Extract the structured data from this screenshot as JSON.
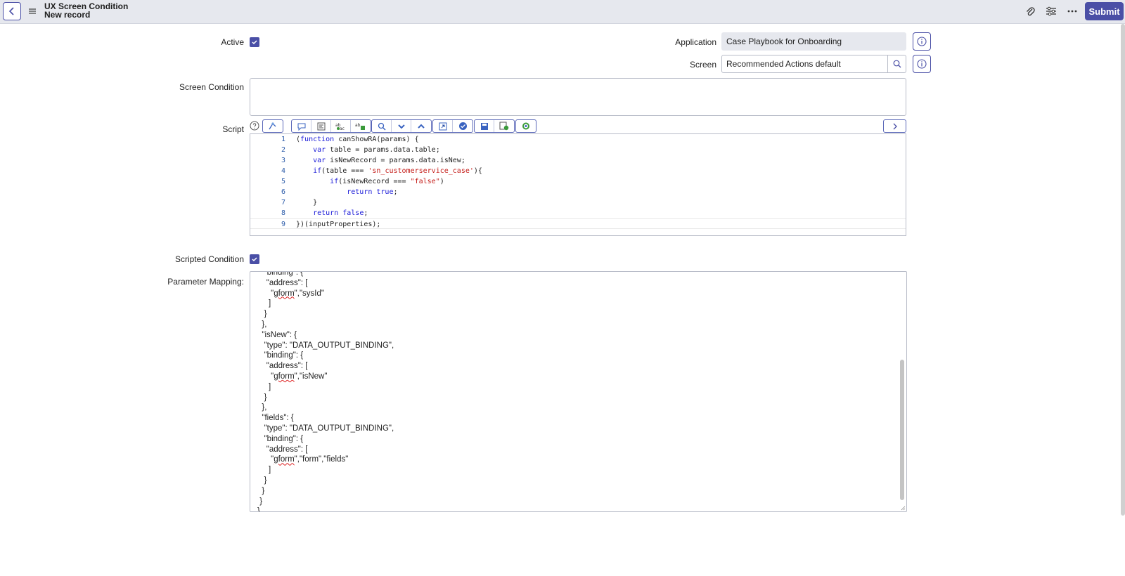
{
  "header": {
    "title": "UX Screen Condition",
    "subtitle": "New record",
    "submit_label": "Submit"
  },
  "form": {
    "active_label": "Active",
    "active_checked": true,
    "application_label": "Application",
    "application_value": "Case Playbook for Onboarding",
    "screen_label": "Screen",
    "screen_value": "Recommended Actions default",
    "screen_condition_label": "Screen Condition",
    "screen_condition_value": "",
    "script_label": "Script",
    "scripted_condition_label": "Scripted Condition",
    "scripted_condition_checked": true,
    "parameter_mapping_label": "Parameter Mapping:"
  },
  "script": {
    "lines": [
      {
        "n": "1",
        "text": "(function canShowRA(params) {"
      },
      {
        "n": "2",
        "text": "    var table = params.data.table;"
      },
      {
        "n": "3",
        "text": "    var isNewRecord = params.data.isNew;"
      },
      {
        "n": "4",
        "text": "    if(table === 'sn_customerservice_case'){"
      },
      {
        "n": "5",
        "text": "        if(isNewRecord === \"false\")"
      },
      {
        "n": "6",
        "text": "            return true;"
      },
      {
        "n": "7",
        "text": "    }"
      },
      {
        "n": "8",
        "text": "    return false;"
      },
      {
        "n": "9",
        "text": "})(inputProperties);"
      }
    ]
  },
  "parameter_mapping": {
    "lines": [
      "   \"binding\": {",
      "    \"address\": [",
      "      \"gform\",\"sysId\"",
      "     ]",
      "   }",
      "  },",
      "  \"isNew\": {",
      "   \"type\": \"DATA_OUTPUT_BINDING\",",
      "   \"binding\": {",
      "    \"address\": [",
      "      \"gform\",\"isNew\"",
      "     ]",
      "   }",
      "  },",
      "  \"fields\": {",
      "   \"type\": \"DATA_OUTPUT_BINDING\",",
      "   \"binding\": {",
      "    \"address\": [",
      "      \"gform\",\"form\",\"fields\"",
      "     ]",
      "   }",
      "  }",
      " }",
      "}"
    ]
  },
  "colors": {
    "accent": "#4a4fa6",
    "header_bg": "#e6e8ee"
  }
}
